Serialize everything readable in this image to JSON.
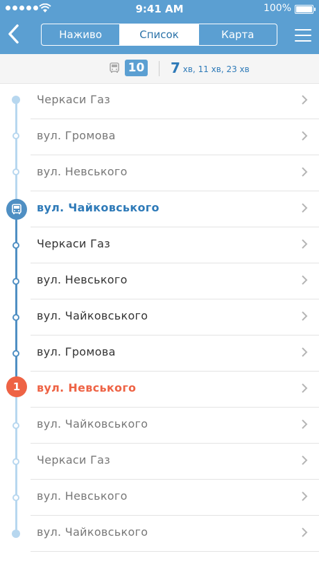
{
  "status": {
    "time": "9:41 AM",
    "battery": "100%"
  },
  "nav": {
    "tabs": [
      {
        "label": "Наживо"
      },
      {
        "label": "Список"
      },
      {
        "label": "Карта"
      }
    ]
  },
  "info": {
    "route_number": "10",
    "first_minutes": "7",
    "first_unit": "хв",
    "rest": ", 11 хв, 23 хв"
  },
  "stops": [
    {
      "name": "Черкаси Газ"
    },
    {
      "name": "вул. Громова"
    },
    {
      "name": "вул. Невського"
    },
    {
      "name": "вул. Чайковського"
    },
    {
      "name": "Черкаси Газ"
    },
    {
      "name": "вул. Невського"
    },
    {
      "name": "вул. Чайковського"
    },
    {
      "name": "вул. Громова"
    },
    {
      "name": "вул. Невського"
    },
    {
      "name": "вул. Чайковського"
    },
    {
      "name": "Черкаси Газ"
    },
    {
      "name": "вул. Невського"
    },
    {
      "name": "вул. Чайковського"
    }
  ],
  "current_stop_marker": "1"
}
